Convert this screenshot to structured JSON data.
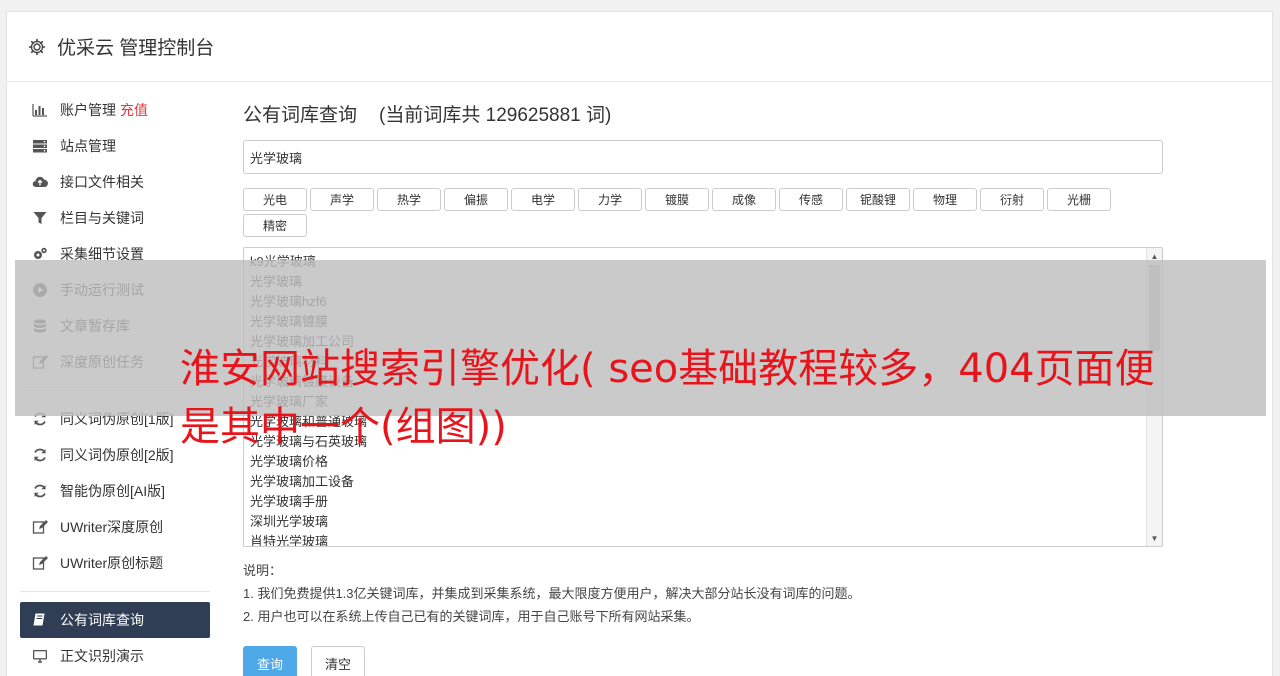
{
  "header": {
    "title": "优采云 管理控制台",
    "icon": "gear-icon"
  },
  "sidebar": {
    "group1": [
      {
        "label": "账户管理",
        "extra": "充值",
        "icon": "bar-chart-icon"
      },
      {
        "label": "站点管理",
        "icon": "server-icon"
      },
      {
        "label": "接口文件相关",
        "icon": "cloud-upload-icon"
      },
      {
        "label": "栏目与关键词",
        "icon": "filter-icon"
      },
      {
        "label": "采集细节设置",
        "icon": "gears-icon"
      },
      {
        "label": "手动运行测试",
        "icon": "play-icon"
      },
      {
        "label": "文章暂存库",
        "icon": "database-icon"
      },
      {
        "label": "深度原创任务",
        "icon": "edit-icon"
      }
    ],
    "group2": [
      {
        "label": "同义词伪原创[1版]",
        "icon": "refresh-icon"
      },
      {
        "label": "同义词伪原创[2版]",
        "icon": "refresh-icon"
      },
      {
        "label": "智能伪原创[AI版]",
        "icon": "refresh-icon"
      },
      {
        "label": "UWriter深度原创",
        "icon": "edit-icon"
      },
      {
        "label": "UWriter原创标题",
        "icon": "edit-icon"
      }
    ],
    "group3": [
      {
        "label": "公有词库查询",
        "icon": "book-icon",
        "active": true
      },
      {
        "label": "正文识别演示",
        "icon": "monitor-icon"
      }
    ]
  },
  "main": {
    "title": "公有词库查询",
    "count_text": "(当前词库共 129625881 词)",
    "search_value": "光学玻璃",
    "tags": [
      "光电",
      "声学",
      "热学",
      "偏振",
      "电学",
      "力学",
      "镀膜",
      "成像",
      "传感",
      "铌酸锂",
      "物理",
      "衍射",
      "光栅",
      "精密"
    ],
    "results": [
      "k9光学玻璃",
      "光学玻璃",
      "光学玻璃hzf6",
      "光学玻璃镀膜",
      "光学玻璃加工公司",
      "光学玻璃材料",
      "光学玻璃镀膜设备",
      "光学玻璃厂家",
      "光学玻璃和普通玻璃",
      "光学玻璃与石英玻璃",
      "光学玻璃价格",
      "光学玻璃加工设备",
      "光学玻璃手册",
      "深圳光学玻璃",
      "肖特光学玻璃"
    ],
    "notes_title": "说明：",
    "notes": [
      "1. 我们免费提供1.3亿关键词库，并集成到采集系统，最大限度方便用户，解决大部分站长没有词库的问题。",
      "2. 用户也可以在系统上传自己已有的关键词库，用于自己账号下所有网站采集。"
    ],
    "query_button": "查询",
    "clear_button": "清空"
  },
  "overlay": {
    "title": "淮安网站搜索引擎优化( seo基础教程较多，404页面便是其中一个(组图))"
  },
  "colors": {
    "overlay_text": "#e8141b",
    "active_nav": "#2f3e55",
    "primary_button": "#4fa8e8",
    "recharge": "#e4393c"
  }
}
